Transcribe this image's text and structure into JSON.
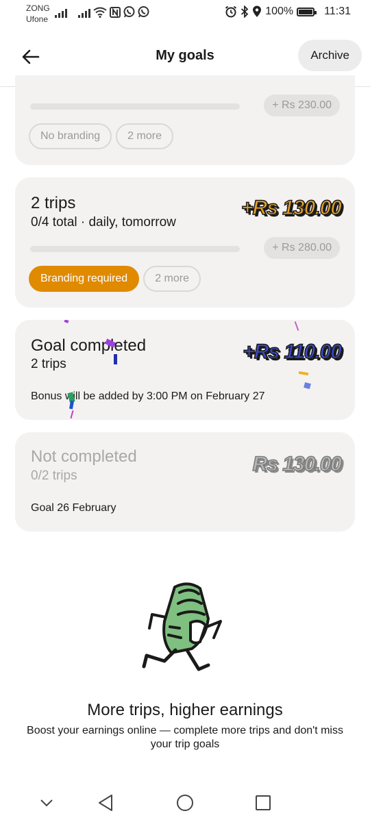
{
  "status_bar": {
    "carrier_1": "ZONG",
    "carrier_2": "Ufone",
    "battery_text": "100%",
    "time": "11:31"
  },
  "header": {
    "title": "My goals",
    "archive_label": "Archive"
  },
  "goals": [
    {
      "amount_pill": "+ Rs 230.00",
      "progress": 0,
      "tags": [
        "No branding",
        "2 more"
      ]
    },
    {
      "title": "2 trips",
      "subtitle": "0/4 total · daily, tomorrow",
      "reward": "+Rs 130.00",
      "amount_pill": "+ Rs 280.00",
      "progress": 0,
      "tags": [
        "Branding required",
        "2 more"
      ]
    },
    {
      "title": "Goal completed",
      "subtitle": "2 trips",
      "reward": "+Rs 110.00",
      "note": "Bonus will be added by 3:00 PM on February 27"
    },
    {
      "title": "Not completed",
      "subtitle": "0/2 trips",
      "reward": "Rs 130.00",
      "note": "Goal 26 February"
    }
  ],
  "promo": {
    "title": "More trips, higher earnings",
    "body": "Boost your earnings online — complete more trips and don't miss your trip goals"
  },
  "colors": {
    "branding_required": "#e08a00",
    "reward_gold": "#e6a02a",
    "reward_blue": "#3a4ac4",
    "card_bg": "#f3f2f1"
  },
  "icons": [
    "signal-icon",
    "wifi-icon",
    "nfc-icon",
    "whatsapp-icon",
    "alarm-icon",
    "bluetooth-icon",
    "location-icon",
    "battery-icon",
    "back-arrow-icon",
    "running-money-icon",
    "nav-collapse-icon",
    "nav-back-icon",
    "nav-home-icon",
    "nav-recents-icon"
  ]
}
